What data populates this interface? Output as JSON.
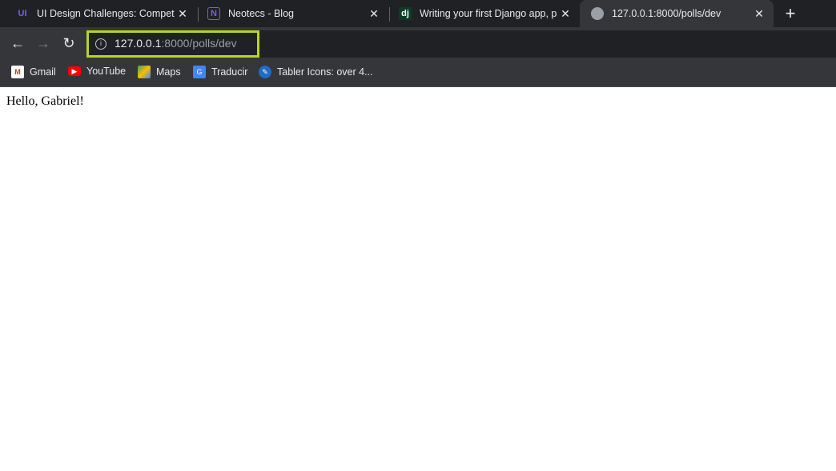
{
  "tabs": [
    {
      "title": "UI Design Challenges: Compete",
      "icon": "uidesign-logo-icon",
      "active": false
    },
    {
      "title": "Neotecs - Blog",
      "icon": "notion-logo-icon",
      "active": false
    },
    {
      "title": "Writing your first Django app, pa",
      "icon": "django-logo-icon",
      "active": false
    },
    {
      "title": "127.0.0.1:8000/polls/dev",
      "icon": "globe-icon",
      "active": true
    }
  ],
  "address": {
    "host": "127.0.0.1",
    "rest": ":8000/polls/dev",
    "highlight_color": "#b5d622"
  },
  "bookmarks": [
    {
      "label": "Gmail",
      "icon": "gmail-icon"
    },
    {
      "label": "YouTube",
      "icon": "youtube-icon"
    },
    {
      "label": "Maps",
      "icon": "maps-icon"
    },
    {
      "label": "Traducir",
      "icon": "translate-icon"
    },
    {
      "label": "Tabler Icons: over 4...",
      "icon": "tabler-icon"
    }
  ],
  "page": {
    "greeting": "Hello, Gabriel!"
  }
}
